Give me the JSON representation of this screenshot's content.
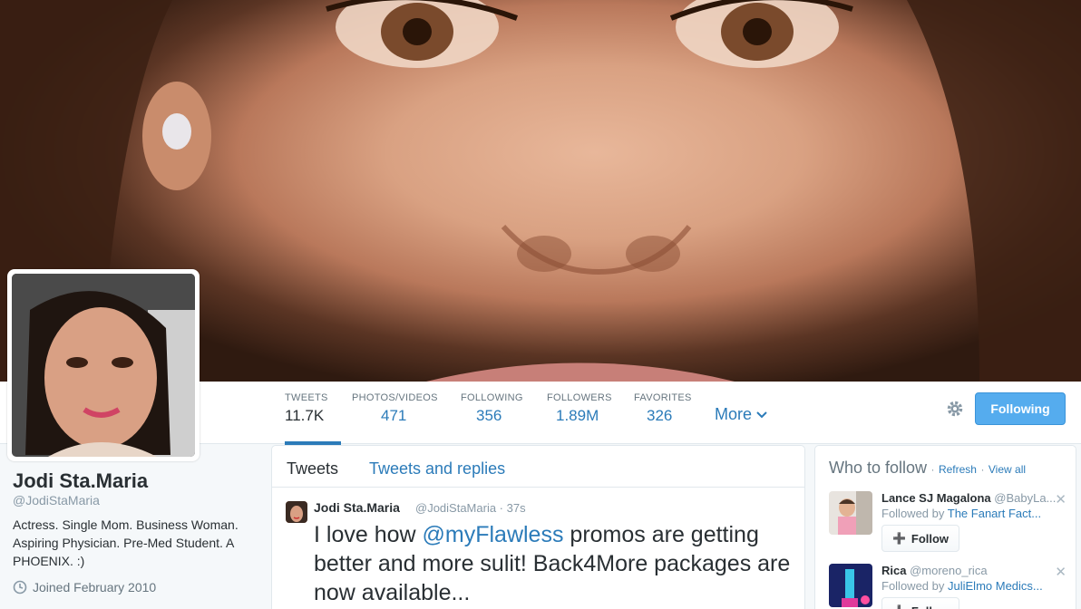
{
  "profile": {
    "name": "Jodi Sta.Maria",
    "handle": "@JodiStaMaria",
    "bio": "Actress. Single Mom. Business Woman. Aspiring Physician. Pre-Med Student. A PHOENIX. :)",
    "joined": "Joined February 2010"
  },
  "nav": {
    "stats": [
      {
        "label": "TWEETS",
        "value": "11.7K"
      },
      {
        "label": "PHOTOS/VIDEOS",
        "value": "471"
      },
      {
        "label": "FOLLOWING",
        "value": "356"
      },
      {
        "label": "FOLLOWERS",
        "value": "1.89M"
      },
      {
        "label": "FAVORITES",
        "value": "326"
      }
    ],
    "more_label": "More",
    "follow_button": "Following"
  },
  "timeline": {
    "tabs": [
      "Tweets",
      "Tweets and replies"
    ],
    "tweet": {
      "name": "Jodi Sta.Maria",
      "handle_time": "@JodiStaMaria · 37s",
      "text_before": "I love how ",
      "mention": "@myFlawless",
      "text_after": " promos are getting better and more sulit! Back4More packages are now available..."
    }
  },
  "who_to_follow": {
    "title": "Who to follow",
    "sep": "·",
    "refresh": "Refresh",
    "view_all": "View all",
    "follow_label": "Follow",
    "suggestions": [
      {
        "name": "Lance SJ Magalona",
        "handle": "@BabyLa...",
        "followed_by_prefix": "Followed by",
        "followed_by": "The Fanart Fact..."
      },
      {
        "name": "Rica",
        "handle": "@moreno_rica",
        "followed_by_prefix": "Followed by",
        "followed_by": "JuliElmo Medics..."
      }
    ]
  },
  "icons": {
    "settings": "gear-icon",
    "more": "chevron-down-icon",
    "joined": "clock-icon",
    "follow": "add-user-icon",
    "close": "close-icon"
  },
  "colors": {
    "accent": "#2b7bb9",
    "follow_button": "#55acee",
    "background": "#f5f8fa"
  }
}
